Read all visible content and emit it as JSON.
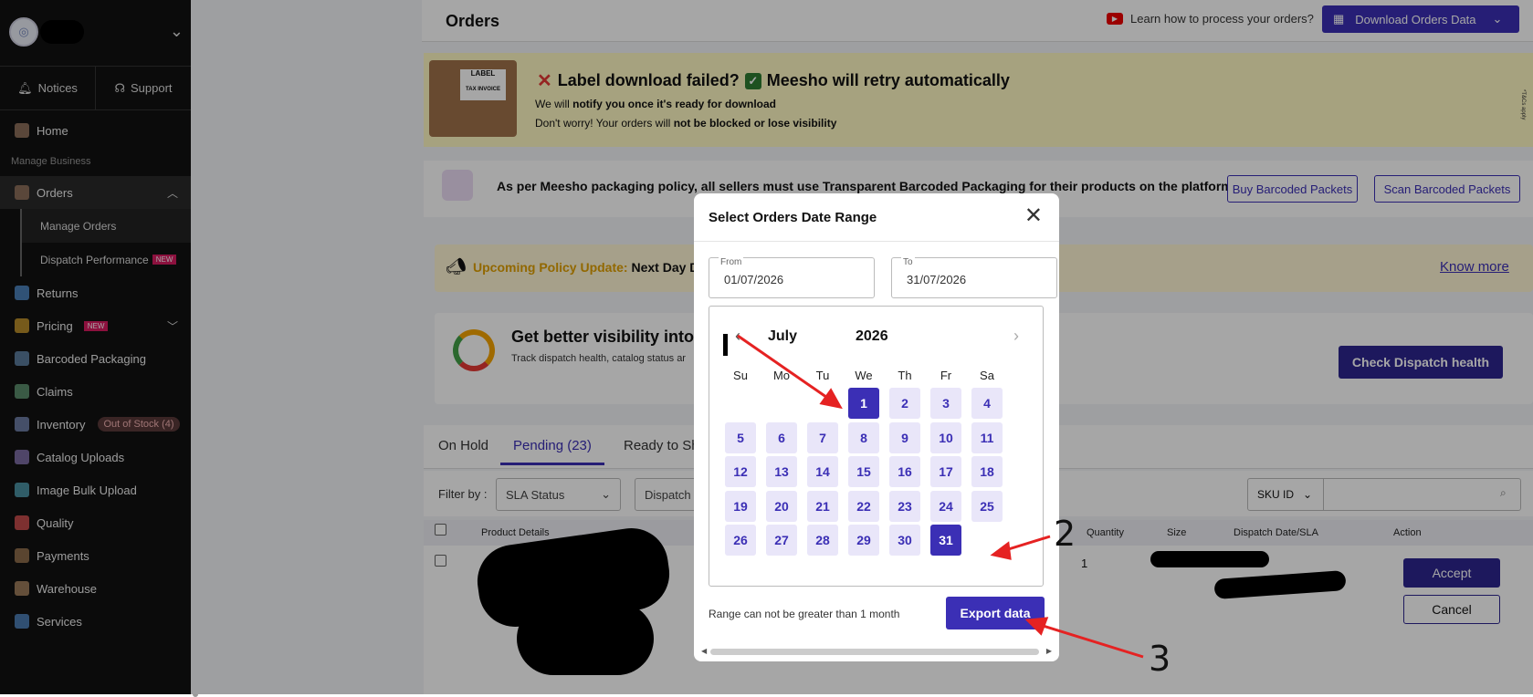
{
  "sidebar": {
    "notices": "Notices",
    "support": "Support",
    "items": [
      {
        "label": "Home"
      },
      {
        "label": "Orders"
      },
      {
        "label": "Returns"
      },
      {
        "label": "Pricing"
      },
      {
        "label": "Barcoded Packaging"
      },
      {
        "label": "Claims"
      },
      {
        "label": "Inventory"
      },
      {
        "label": "Catalog Uploads"
      },
      {
        "label": "Image Bulk Upload"
      },
      {
        "label": "Quality"
      },
      {
        "label": "Payments"
      },
      {
        "label": "Warehouse"
      },
      {
        "label": "Services"
      }
    ],
    "section_manage": "Manage Business",
    "sub_manage_orders": "Manage Orders",
    "sub_dispatch": "Dispatch Performance",
    "new_badge": "NEW",
    "out_of_stock": "Out of Stock (4)"
  },
  "header": {
    "title": "Orders",
    "learn": "Learn how to process your orders?",
    "download": "Download Orders Data"
  },
  "banner_label": {
    "title_part1": "Label download failed?",
    "title_part2": "Meesho will retry automatically",
    "line1_a": "We will ",
    "line1_b": "notify you once it's ready for download",
    "line2_a": "Don't worry! Your orders will ",
    "line2_b": "not be blocked or lose visibility",
    "box_label": "LABEL",
    "box_tax": "TAX INVOICE",
    "tiny": "*T&Cs apply"
  },
  "banner_packaging": {
    "text": "As per Meesho packaging policy, all sellers must use Transparent Barcoded Packaging for their products on the platform.",
    "buy": "Buy Barcoded Packets",
    "scan": "Scan Barcoded Packets"
  },
  "banner_policy": {
    "label": "Upcoming Policy Update:",
    "text": " Next Day D",
    "link": "Know more"
  },
  "banner_dispatch": {
    "title": "Get better visibility into",
    "sub": "Track dispatch health, catalog status ar",
    "button": "Check Dispatch health"
  },
  "tabs": [
    "On Hold",
    "Pending (23)",
    "Ready to Sh"
  ],
  "filters": {
    "label": "Filter by :",
    "sla": "SLA Status",
    "dispatch": "Dispatch",
    "sku": "SKU ID"
  },
  "table": {
    "headers": [
      "Product Details",
      "Quantity",
      "Size",
      "Dispatch Date/SLA",
      "Action"
    ],
    "row_qty": "1",
    "accept": "Accept",
    "cancel": "Cancel"
  },
  "modal": {
    "title": "Select Orders Date Range",
    "from_label": "From",
    "from_value": "01/07/2026",
    "to_label": "To",
    "to_value": "31/07/2026",
    "month": "July",
    "year": "2026",
    "weekdays": [
      "Su",
      "Mo",
      "Tu",
      "We",
      "Th",
      "Fr",
      "Sa"
    ],
    "days": [
      "1",
      "2",
      "3",
      "4",
      "5",
      "6",
      "7",
      "8",
      "9",
      "10",
      "11",
      "12",
      "13",
      "14",
      "15",
      "16",
      "17",
      "18",
      "19",
      "20",
      "21",
      "22",
      "23",
      "24",
      "25",
      "26",
      "27",
      "28",
      "29",
      "30",
      "31"
    ],
    "selected_start": 1,
    "selected_end": 31,
    "first_weekday_index": 3,
    "note": "Range can not be greater than 1 month",
    "export": "Export data"
  },
  "annotations": {
    "n2": "2",
    "n3": "3"
  },
  "colors": {
    "accent": "#3b2fb5",
    "arrow": "#e52222",
    "sidebar": "#111111"
  }
}
